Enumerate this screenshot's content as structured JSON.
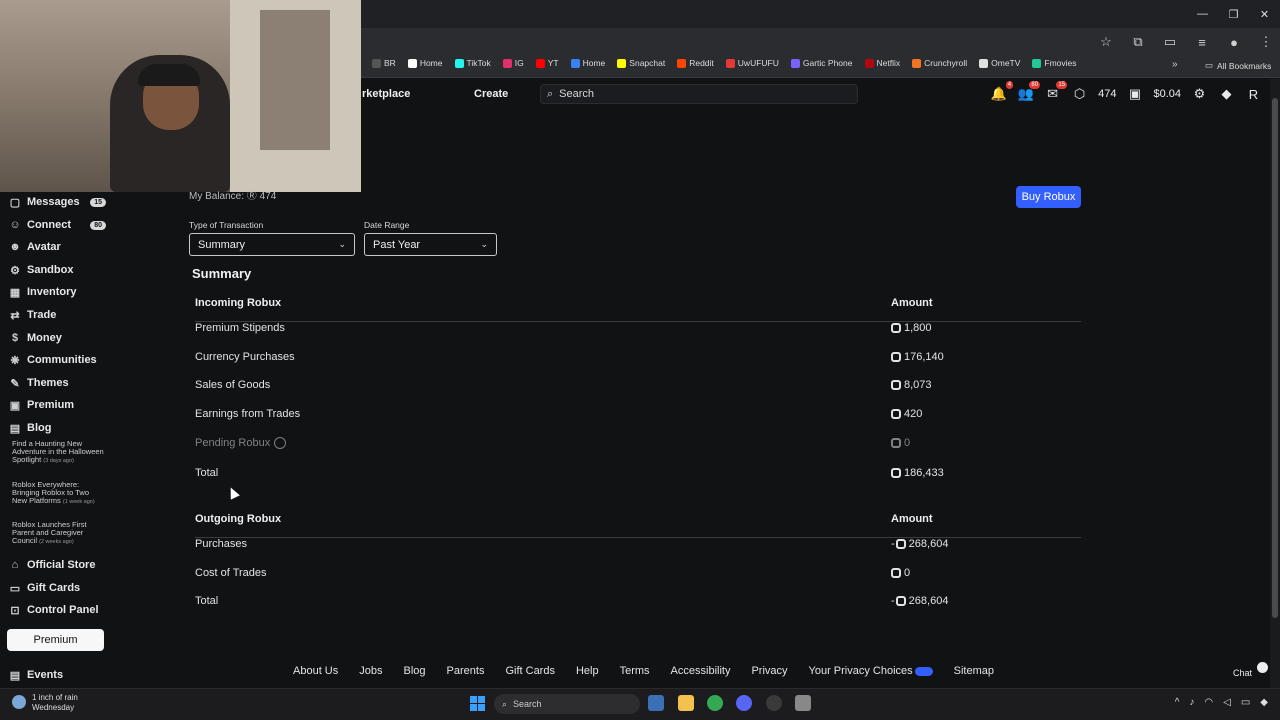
{
  "browser": {
    "bookmarks": [
      "BR",
      "Home",
      "TikTok",
      "IG",
      "YT",
      "Home",
      "Snapchat",
      "Reddit",
      "UwUFUFU",
      "Gartic Phone",
      "Netflix",
      "Crunchyroll",
      "OmeTV",
      "Fmovies"
    ],
    "bookmark_colors": [
      "#555555",
      "#ffffff",
      "#25f4ee",
      "#e1306c",
      "#ff0000",
      "#3b82f6",
      "#fffc00",
      "#ff4500",
      "#e53935",
      "#7b61ff",
      "#b00710",
      "#f47521",
      "#e0e0e0",
      "#20c997"
    ],
    "all_bookmarks": "All Bookmarks",
    "more": "»"
  },
  "header": {
    "marketplace": "rketplace",
    "create": "Create",
    "search_placeholder": "Search",
    "notif_count": "4",
    "friends_count": "80",
    "messages_count": "15",
    "robux": "474",
    "balance": "$0.04"
  },
  "sidebar": {
    "items": [
      {
        "label": "Messages",
        "icon": "messages-icon",
        "badge": "15"
      },
      {
        "label": "Connect",
        "icon": "connect-icon",
        "badge": "80"
      },
      {
        "label": "Avatar",
        "icon": "avatar-icon",
        "badge": ""
      },
      {
        "label": "Sandbox",
        "icon": "sandbox-icon",
        "badge": ""
      },
      {
        "label": "Inventory",
        "icon": "inventory-icon",
        "badge": ""
      },
      {
        "label": "Trade",
        "icon": "trade-icon",
        "badge": ""
      },
      {
        "label": "Money",
        "icon": "money-icon",
        "badge": ""
      },
      {
        "label": "Communities",
        "icon": "communities-icon",
        "badge": ""
      },
      {
        "label": "Themes",
        "icon": "themes-icon",
        "badge": ""
      },
      {
        "label": "Premium",
        "icon": "premium-icon",
        "badge": ""
      },
      {
        "label": "Blog",
        "icon": "blog-icon",
        "badge": ""
      }
    ],
    "blog_posts": [
      {
        "title": "Find a Haunting New Adventure in the Halloween Spotlight",
        "time": "(3 days ago)"
      },
      {
        "title": "Roblox Everywhere: Bringing Roblox to Two New Platforms",
        "time": "(1 week ago)"
      },
      {
        "title": "Roblox Launches First Parent and Caregiver Council",
        "time": "(2 weeks ago)"
      }
    ],
    "bottom_items": [
      {
        "label": "Official Store",
        "icon": "store-icon"
      },
      {
        "label": "Gift Cards",
        "icon": "gift-card-icon"
      },
      {
        "label": "Control Panel",
        "icon": "control-panel-icon"
      }
    ],
    "premium_button": "Premium",
    "events": "Events"
  },
  "main": {
    "balance_label": "My Balance: Ⓡ 474",
    "buy_robux": "Buy Robux",
    "type_label": "Type of Transaction",
    "type_value": "Summary",
    "date_label": "Date Range",
    "date_value": "Past Year",
    "summary_heading": "Summary",
    "incoming": {
      "header": "Incoming Robux",
      "amount_header": "Amount",
      "rows": [
        {
          "label": "Premium Stipends",
          "amount": "1,800"
        },
        {
          "label": "Currency Purchases",
          "amount": "176,140"
        },
        {
          "label": "Sales of Goods",
          "amount": "8,073"
        },
        {
          "label": "Earnings from Trades",
          "amount": "420"
        },
        {
          "label": "Pending Robux",
          "amount": "0"
        },
        {
          "label": "Total",
          "amount": "186,433"
        }
      ]
    },
    "outgoing": {
      "header": "Outgoing Robux",
      "amount_header": "Amount",
      "rows": [
        {
          "label": "Purchases",
          "amount": "268,604",
          "sign": "-"
        },
        {
          "label": "Cost of Trades",
          "amount": "0",
          "sign": ""
        },
        {
          "label": "Total",
          "amount": "268,604",
          "sign": "-"
        }
      ]
    }
  },
  "footer": {
    "links": [
      "About Us",
      "Jobs",
      "Blog",
      "Parents",
      "Gift Cards",
      "Help",
      "Terms",
      "Accessibility",
      "Privacy",
      "Your Privacy Choices",
      "Sitemap"
    ],
    "chat": "Chat"
  },
  "taskbar": {
    "weather_title": "1 inch of rain",
    "weather_day": "Wednesday",
    "search": "Search"
  },
  "colors": {
    "accent": "#335fff",
    "background": "#111214",
    "badge": "#e53935"
  }
}
